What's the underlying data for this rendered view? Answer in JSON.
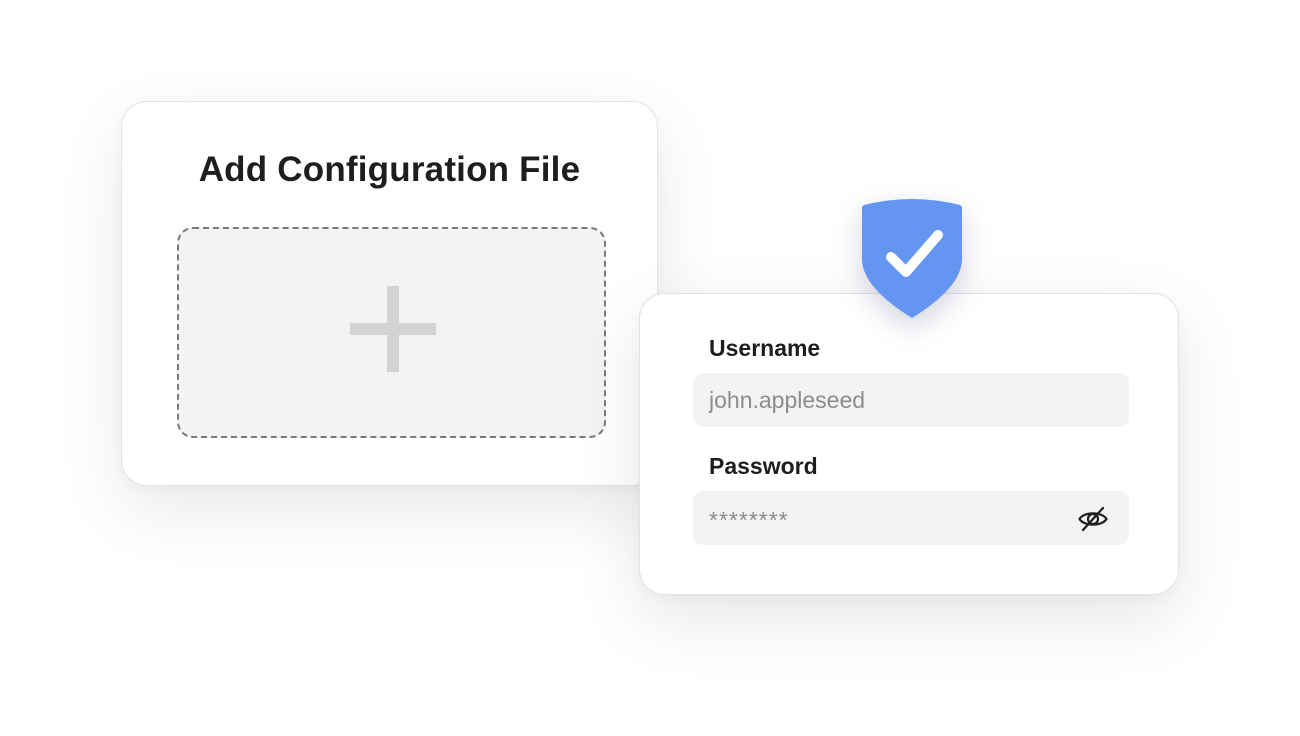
{
  "upload_card": {
    "title": "Add Configuration File",
    "dropzone_icon": "plus-icon"
  },
  "login_card": {
    "badge_icon": "shield-check-icon",
    "username": {
      "label": "Username",
      "value": "john.appleseed"
    },
    "password": {
      "label": "Password",
      "value": "********",
      "toggle_icon": "eye-slash-icon"
    }
  },
  "colors": {
    "accent_blue": "#6495f0",
    "field_background": "#f3f3f3",
    "text_dark": "#1e1e1e",
    "text_muted": "#8c8c8c",
    "plus_gray": "#d3d3d3"
  }
}
